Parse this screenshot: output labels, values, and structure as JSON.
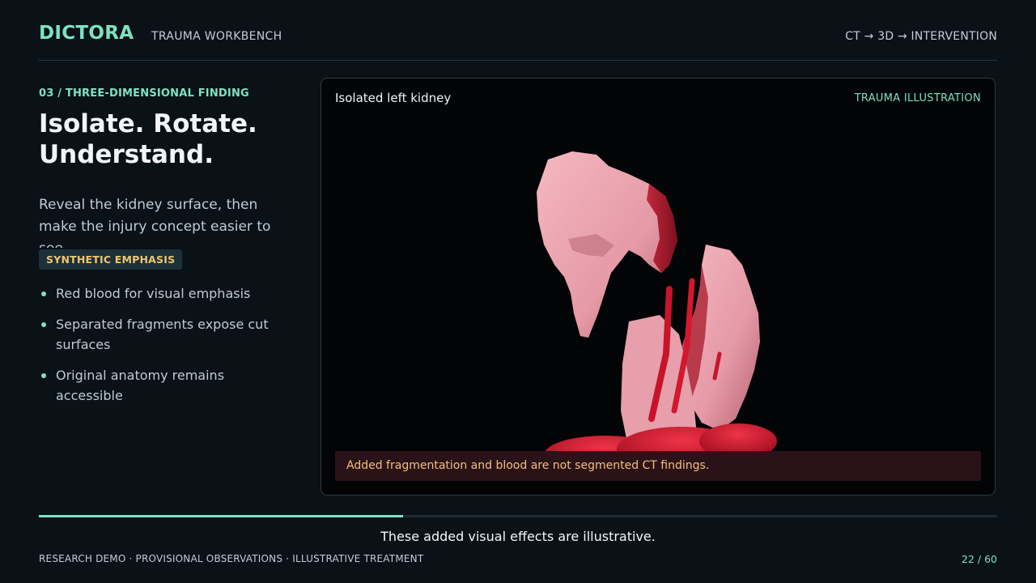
{
  "header": {
    "brand": "DICTORA",
    "app_name": "TRAUMA WORKBENCH",
    "pipeline": "CT → 3D → INTERVENTION"
  },
  "sidebar": {
    "step": "03 / THREE-DIMENSIONAL FINDING",
    "title_line1": "Isolate. Rotate.",
    "title_line2": "Understand.",
    "lead": "Reveal the kidney surface, then make the injury concept easier to see.",
    "tag": "SYNTHETIC EMPHASIS",
    "bullets": [
      "Red blood for visual emphasis",
      "Separated fragments expose cut surfaces",
      "Original anatomy remains accessible"
    ]
  },
  "viewer": {
    "title": "Isolated left kidney",
    "badge": "TRAUMA ILLUSTRATION",
    "warning": "Added fragmentation and blood are not segmented CT findings."
  },
  "progress": {
    "current": 22,
    "total": 60,
    "fraction": 0.38
  },
  "caption": "These added visual effects are illustrative.",
  "footer": {
    "left": "RESEARCH DEMO · PROVISIONAL OBSERVATIONS · ILLUSTRATIVE TREATMENT",
    "slide_counter": "22 / 60"
  },
  "colors": {
    "accent": "#7de3c0",
    "warning_text": "#f2c07a",
    "tag_text": "#f0c56b",
    "tissue": "#e8a0aa",
    "blood": "#d01a2e"
  }
}
